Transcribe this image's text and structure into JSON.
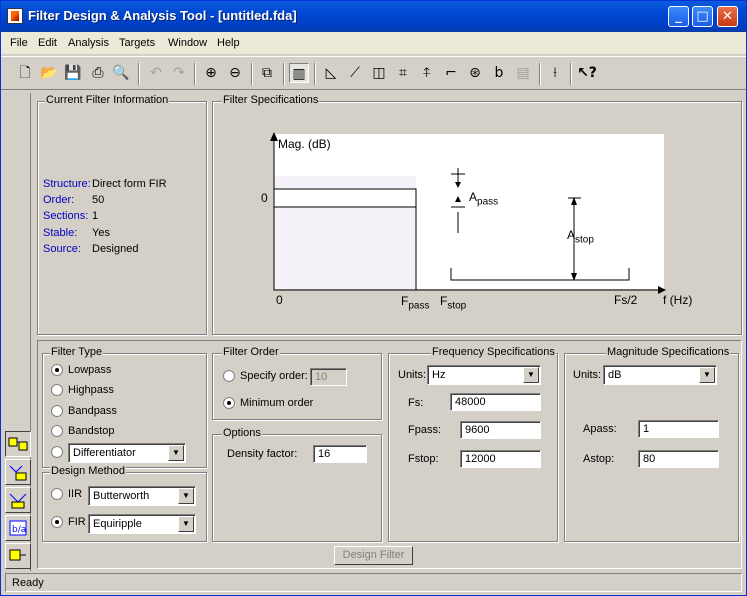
{
  "window": {
    "title": "Filter Design & Analysis Tool - [untitled.fda]"
  },
  "menu": [
    "File",
    "Edit",
    "Analysis",
    "Targets",
    "Window",
    "Help"
  ],
  "toolbar_icons": [
    "new-icon",
    "open-icon",
    "save-icon",
    "print-icon",
    "print-preview-icon",
    "undo-icon",
    "redo-icon",
    "zoom-in-icon",
    "zoom-out-icon",
    "full-view-icon",
    "filter-specs-icon",
    "magnitude-response-icon",
    "phase-response-icon",
    "magnitude-phase-icon",
    "group-delay-icon",
    "impulse-response-icon",
    "step-response-icon",
    "pole-zero-icon",
    "filter-coefficients-icon",
    "filter-info-icon",
    "new-analysis-icon",
    "whats-this-icon"
  ],
  "current_filter": {
    "title": "Current Filter Information",
    "rows": [
      {
        "key": "Structure:",
        "value": "Direct form FIR"
      },
      {
        "key": "Order:",
        "value": "50"
      },
      {
        "key": "Sections:",
        "value": "1"
      },
      {
        "key": "Stable:",
        "value": "Yes"
      },
      {
        "key": "Source:",
        "value": "Designed"
      }
    ]
  },
  "filter_specs": {
    "title": "Filter Specifications",
    "ylabel": "Mag. (dB)",
    "zero_y": "0",
    "zero_x": "0",
    "apass_main": "A",
    "apass_sub": "pass",
    "astop_main": "A",
    "astop_sub": "stop",
    "fpass_main": "F",
    "fpass_sub": "pass",
    "fstop_main": "F",
    "fstop_sub": "stop",
    "fs2": "Fs/2",
    "xlabel": "f (Hz)"
  },
  "filter_type": {
    "title": "Filter Type",
    "options": [
      "Lowpass",
      "Highpass",
      "Bandpass",
      "Bandstop"
    ],
    "selected": "Lowpass",
    "other_combo": "Differentiator"
  },
  "design_method": {
    "title": "Design Method",
    "iir_label": "IIR",
    "iir_combo": "Butterworth",
    "fir_label": "FIR",
    "fir_combo": "Equiripple",
    "selected": "FIR"
  },
  "filter_order": {
    "title": "Filter Order",
    "specify_label": "Specify order:",
    "specify_value": "10",
    "minimum_label": "Minimum order",
    "selected": "Minimum order"
  },
  "options": {
    "title": "Options",
    "density_label": "Density factor:",
    "density_value": "16"
  },
  "freq_specs": {
    "title": "Frequency Specifications",
    "units_label": "Units:",
    "units_value": "Hz",
    "fs_label": "Fs:",
    "fs_value": "48000",
    "fpass_label": "Fpass:",
    "fpass_value": "9600",
    "fstop_label": "Fstop:",
    "fstop_value": "12000"
  },
  "mag_specs": {
    "title": "Magnitude Specifications",
    "units_label": "Units:",
    "units_value": "dB",
    "apass_label": "Apass:",
    "apass_value": "1",
    "astop_label": "Astop:",
    "astop_value": "80"
  },
  "design_button": "Design Filter",
  "status": "Ready"
}
